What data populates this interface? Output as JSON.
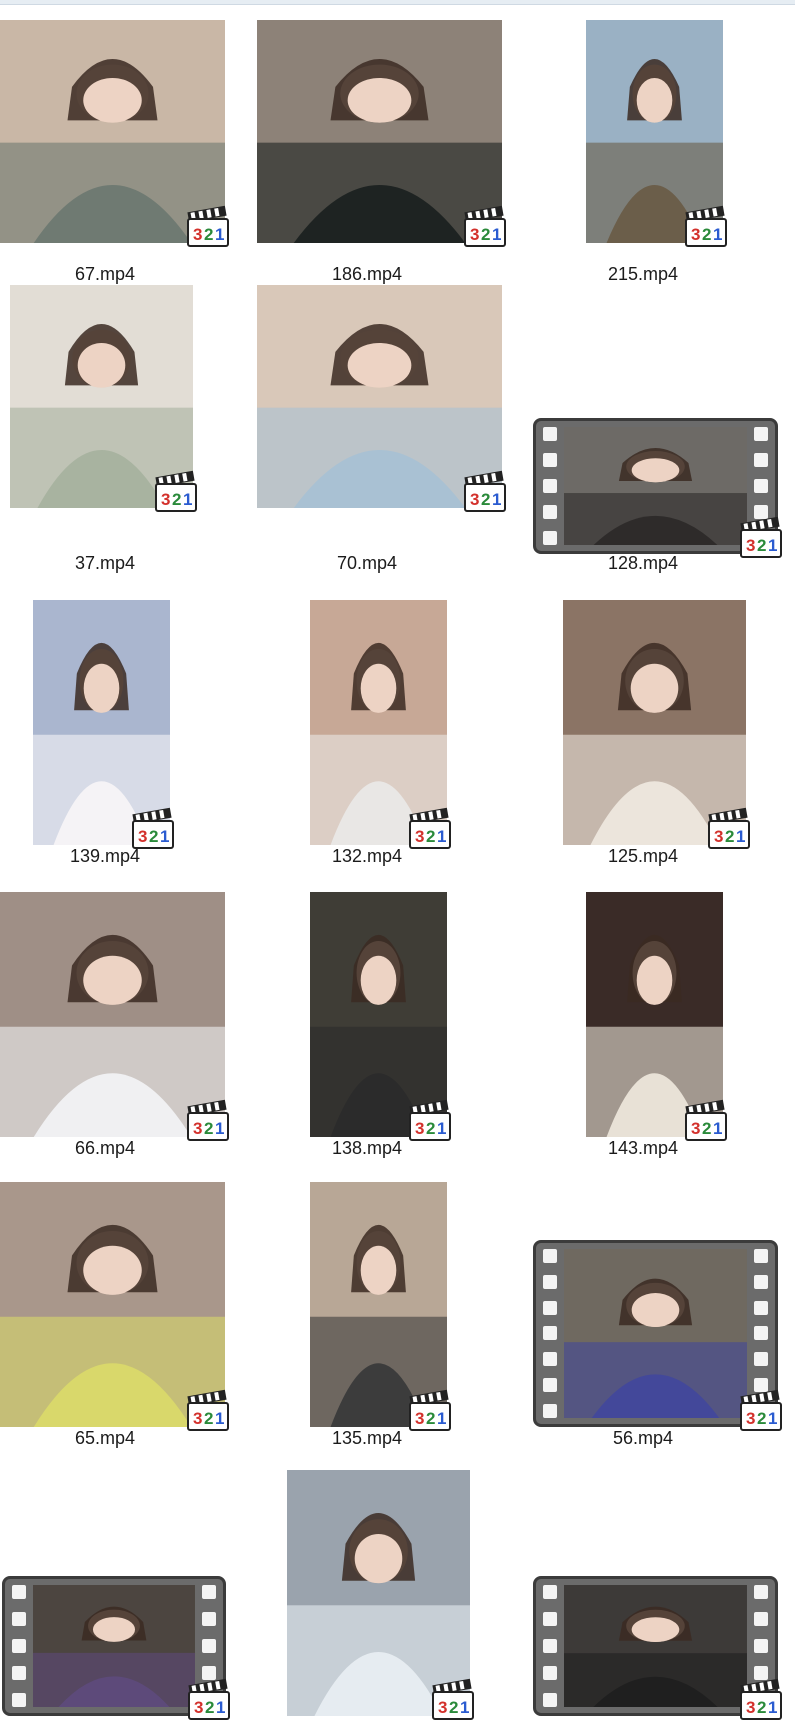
{
  "files": [
    {
      "name": "67.mp4",
      "bg": "#c9b7a6",
      "accent": "#6f7a72",
      "style": "photo"
    },
    {
      "name": "186.mp4",
      "bg": "#8d8278",
      "accent": "#1e2322",
      "style": "photo"
    },
    {
      "name": "215.mp4",
      "bg": "#9ab1c4",
      "accent": "#6b5e4a",
      "style": "photo"
    },
    {
      "name": "37.mp4",
      "bg": "#e2ddd5",
      "accent": "#a8b3a0",
      "style": "photo"
    },
    {
      "name": "70.mp4",
      "bg": "#d9c8b9",
      "accent": "#a9c1d3",
      "style": "photo"
    },
    {
      "name": "128.mp4",
      "bg": "#6d6a66",
      "accent": "#2e2b2a",
      "style": "film"
    },
    {
      "name": "139.mp4",
      "bg": "#aab6cf",
      "accent": "#f5f3f6",
      "style": "photo"
    },
    {
      "name": "132.mp4",
      "bg": "#c7a896",
      "accent": "#e9e7e5",
      "style": "photo"
    },
    {
      "name": "125.mp4",
      "bg": "#8b7465",
      "accent": "#ece5dc",
      "style": "photo"
    },
    {
      "name": "66.mp4",
      "bg": "#9f8f86",
      "accent": "#f0f0f2",
      "style": "photo"
    },
    {
      "name": "138.mp4",
      "bg": "#3f3d36",
      "accent": "#2b2b2b",
      "style": "photo"
    },
    {
      "name": "143.mp4",
      "bg": "#3a2b27",
      "accent": "#e8e1d6",
      "style": "photo"
    },
    {
      "name": "65.mp4",
      "bg": "#a9978b",
      "accent": "#d9d86b",
      "style": "photo"
    },
    {
      "name": "135.mp4",
      "bg": "#b8a796",
      "accent": "#3c3c3c",
      "style": "photo"
    },
    {
      "name": "56.mp4",
      "bg": "#6f6960",
      "accent": "#43489a",
      "style": "film"
    },
    {
      "name": "",
      "bg": "#4c4540",
      "accent": "#5d4a7a",
      "style": "film"
    },
    {
      "name": "",
      "bg": "#9aa3ad",
      "accent": "#e6ecf1",
      "style": "photo"
    },
    {
      "name": "",
      "bg": "#3d3a38",
      "accent": "#1f1f1f",
      "style": "film"
    }
  ]
}
